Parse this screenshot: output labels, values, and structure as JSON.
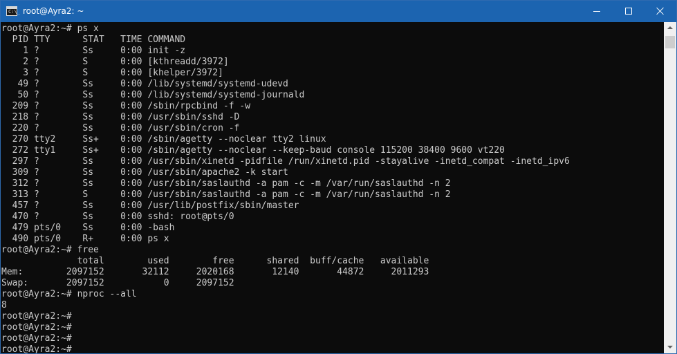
{
  "window": {
    "title": "root@Ayra2: ~",
    "icon": "console-icon",
    "icon_glyph": "C:\\_",
    "colors": {
      "titlebar": "#1c64b0",
      "terminal_bg": "#0c0c0c",
      "terminal_fg": "#cccccc"
    }
  },
  "terminal": {
    "lines": [
      "root@Ayra2:~# ps x",
      "  PID TTY      STAT   TIME COMMAND",
      "    1 ?        Ss     0:00 init -z",
      "    2 ?        S      0:00 [kthreadd/3972]",
      "    3 ?        S      0:00 [khelper/3972]",
      "   49 ?        Ss     0:00 /lib/systemd/systemd-udevd",
      "   50 ?        Ss     0:00 /lib/systemd/systemd-journald",
      "  209 ?        Ss     0:00 /sbin/rpcbind -f -w",
      "  218 ?        Ss     0:00 /usr/sbin/sshd -D",
      "  220 ?        Ss     0:00 /usr/sbin/cron -f",
      "  270 tty2     Ss+    0:00 /sbin/agetty --noclear tty2 linux",
      "  272 tty1     Ss+    0:00 /sbin/agetty --noclear --keep-baud console 115200 38400 9600 vt220",
      "  297 ?        Ss     0:00 /usr/sbin/xinetd -pidfile /run/xinetd.pid -stayalive -inetd_compat -inetd_ipv6",
      "  309 ?        Ss     0:00 /usr/sbin/apache2 -k start",
      "  312 ?        Ss     0:00 /usr/sbin/saslauthd -a pam -c -m /var/run/saslauthd -n 2",
      "  313 ?        S      0:00 /usr/sbin/saslauthd -a pam -c -m /var/run/saslauthd -n 2",
      "  457 ?        Ss     0:00 /usr/lib/postfix/sbin/master",
      "  470 ?        Ss     0:00 sshd: root@pts/0",
      "  479 pts/0    Ss     0:00 -bash",
      "  490 pts/0    R+     0:00 ps x",
      "root@Ayra2:~# free",
      "              total        used        free      shared  buff/cache   available",
      "Mem:        2097152       32112     2020168       12140       44872     2011293",
      "Swap:       2097152           0     2097152",
      "root@Ayra2:~# nproc --all",
      "8",
      "root@Ayra2:~#",
      "root@Ayra2:~#",
      "root@Ayra2:~#",
      "root@Ayra2:~#"
    ]
  }
}
